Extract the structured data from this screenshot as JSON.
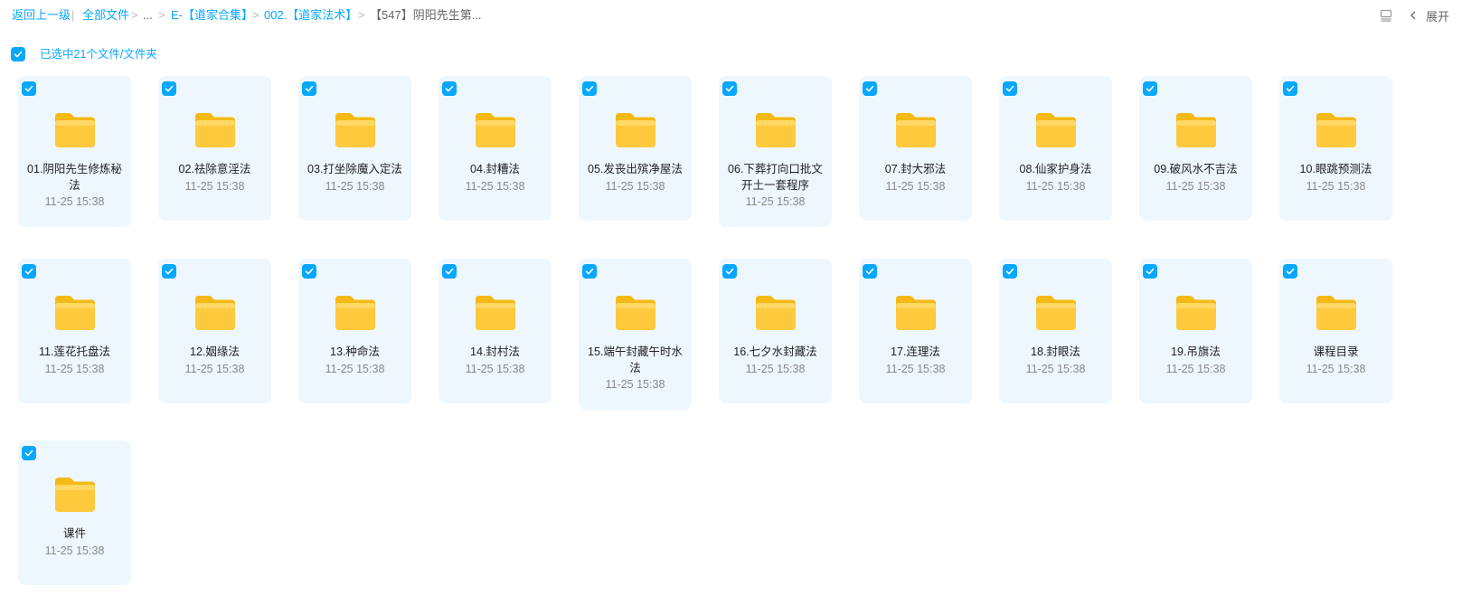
{
  "breadcrumb": {
    "back": "返回上一级",
    "root": "全部文件",
    "ellipsis": "...",
    "level1": "E-【道家合集】",
    "level2": "002.【道家法术】",
    "current": "【547】阴阳先生第..."
  },
  "toolbar": {
    "layout_icon": "list-view-icon",
    "expand_label": "展开"
  },
  "selection": {
    "text": "已选中21个文件/文件夹",
    "checked": true
  },
  "accent_color": "#06a7ff",
  "folders": [
    {
      "name": "01.阴阳先生修炼秘法",
      "date": "11-25 15:38"
    },
    {
      "name": "02.祛除意淫法",
      "date": "11-25 15:38"
    },
    {
      "name": "03.打坐除魔入定法",
      "date": "11-25 15:38"
    },
    {
      "name": "04.封糟法",
      "date": "11-25 15:38"
    },
    {
      "name": "05.发丧出殡净屋法",
      "date": "11-25 15:38"
    },
    {
      "name": "06.下葬打向口批文开土一套程序",
      "date": "11-25 15:38"
    },
    {
      "name": "07.封大邪法",
      "date": "11-25 15:38"
    },
    {
      "name": "08.仙家护身法",
      "date": "11-25 15:38"
    },
    {
      "name": "09.破风水不吉法",
      "date": "11-25 15:38"
    },
    {
      "name": "10.眼跳预测法",
      "date": "11-25 15:38"
    },
    {
      "name": "11.莲花托盘法",
      "date": "11-25 15:38"
    },
    {
      "name": "12.姻缘法",
      "date": "11-25 15:38"
    },
    {
      "name": "13.种命法",
      "date": "11-25 15:38"
    },
    {
      "name": "14.封村法",
      "date": "11-25 15:38"
    },
    {
      "name": "15.端午封藏午时水法",
      "date": "11-25 15:38"
    },
    {
      "name": "16.七夕水封藏法",
      "date": "11-25 15:38"
    },
    {
      "name": "17.连理法",
      "date": "11-25 15:38"
    },
    {
      "name": "18.封眼法",
      "date": "11-25 15:38"
    },
    {
      "name": "19.吊旗法",
      "date": "11-25 15:38"
    },
    {
      "name": "课程目录",
      "date": "11-25 15:38"
    },
    {
      "name": "课件",
      "date": "11-25 15:38"
    }
  ]
}
